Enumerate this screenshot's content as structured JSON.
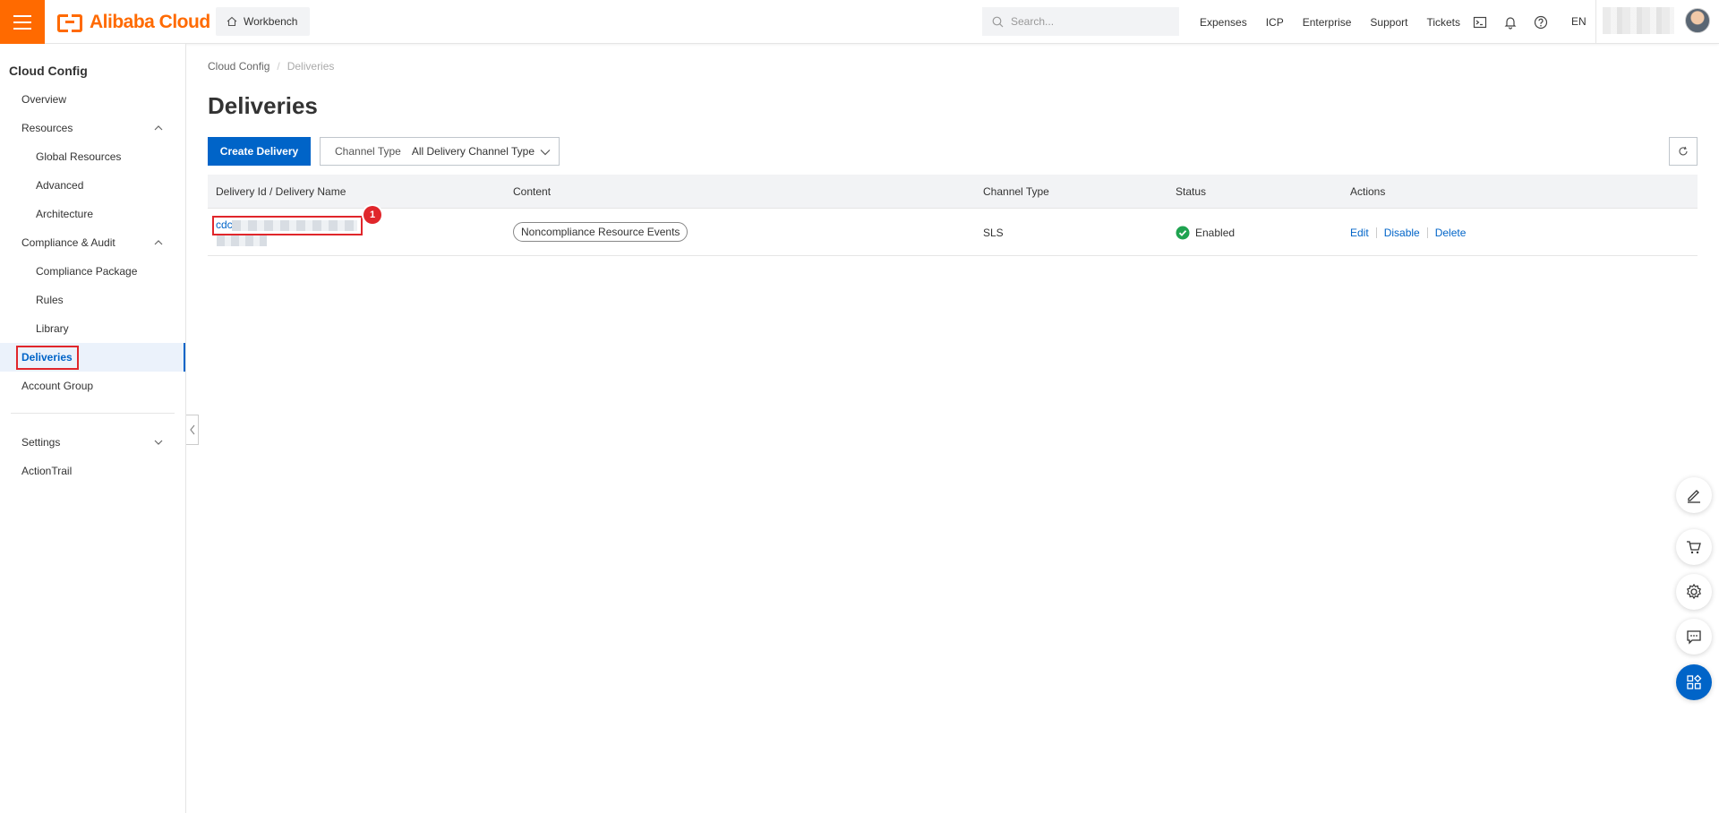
{
  "brand": {
    "name": "Alibaba Cloud",
    "accent": "#ff6a00",
    "primary": "#0064c8",
    "highlight": "#e0262b"
  },
  "topbar": {
    "workbench_label": "Workbench",
    "search_placeholder": "Search...",
    "links": [
      "Expenses",
      "ICP",
      "Enterprise",
      "Support",
      "Tickets"
    ],
    "icons": [
      "terminal-icon",
      "bell-icon",
      "help-icon"
    ],
    "language": "EN"
  },
  "sidebar": {
    "title": "Cloud Config",
    "items": [
      {
        "label": "Overview",
        "level": 1
      },
      {
        "label": "Resources",
        "level": 1,
        "expanded": true
      },
      {
        "label": "Global Resources",
        "level": 2
      },
      {
        "label": "Advanced",
        "level": 2
      },
      {
        "label": "Architecture",
        "level": 2
      },
      {
        "label": "Compliance & Audit",
        "level": 1,
        "expanded": true
      },
      {
        "label": "Compliance Package",
        "level": 2
      },
      {
        "label": "Rules",
        "level": 2
      },
      {
        "label": "Library",
        "level": 2
      },
      {
        "label": "Deliveries",
        "level": 1,
        "active": true
      },
      {
        "label": "Account Group",
        "level": 1
      },
      {
        "label": "Settings",
        "level": 1,
        "expanded": false
      },
      {
        "label": "ActionTrail",
        "level": 1
      }
    ]
  },
  "breadcrumb": {
    "root": "Cloud Config",
    "separator": "/",
    "current": "Deliveries"
  },
  "page": {
    "title": "Deliveries",
    "create_button": "Create Delivery",
    "filter": {
      "label": "Channel Type",
      "value": "All Delivery Channel Type"
    }
  },
  "table": {
    "headers": [
      "Delivery Id / Delivery Name",
      "Content",
      "Channel Type",
      "Status",
      "Actions"
    ],
    "rows": [
      {
        "id_prefix": "cdc",
        "content": "Noncompliance Resource Events",
        "channel_type": "SLS",
        "status": "Enabled",
        "actions": [
          "Edit",
          "Disable",
          "Delete"
        ]
      }
    ]
  },
  "annotation": {
    "step_number": "1"
  }
}
